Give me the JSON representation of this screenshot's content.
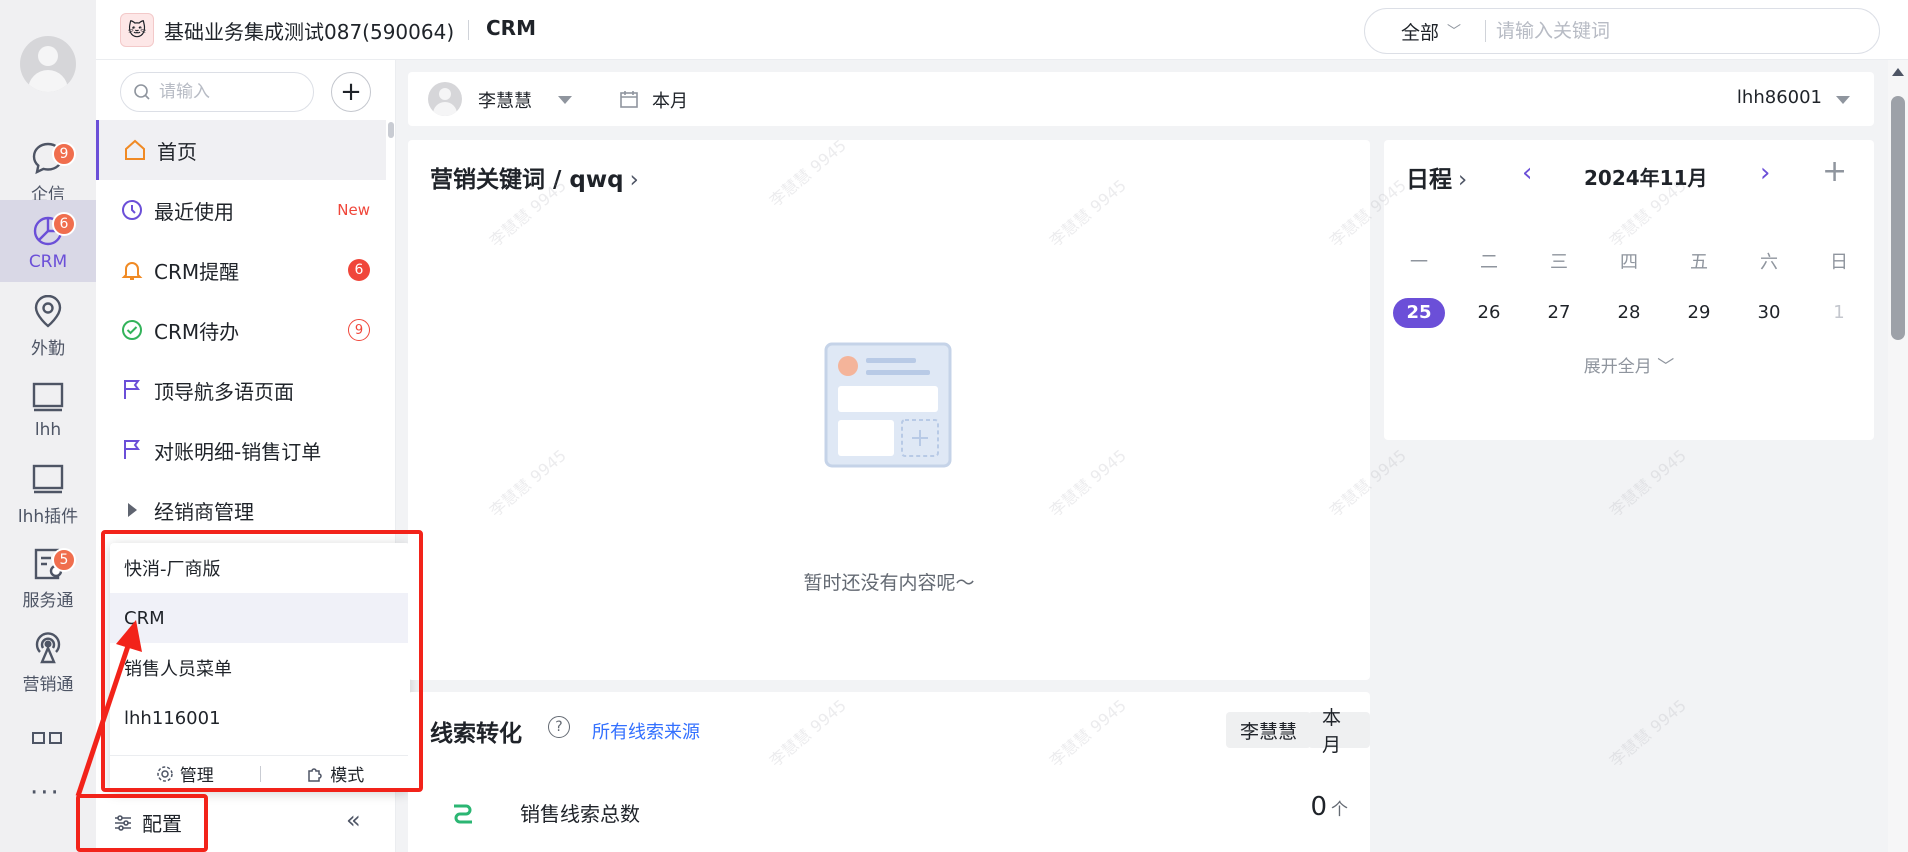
{
  "rail": {
    "items": [
      {
        "label": "企信",
        "badge": "9",
        "icon": "chat-bubble-icon"
      },
      {
        "label": "CRM",
        "badge": "6",
        "icon": "pie-chart-icon"
      },
      {
        "label": "外勤",
        "badge": "",
        "icon": "location-pin-icon"
      },
      {
        "label": "lhh",
        "badge": "",
        "icon": "monitor-icon"
      },
      {
        "label": "lhh插件",
        "badge": "",
        "icon": "monitor-icon"
      },
      {
        "label": "服务通",
        "badge": "5",
        "icon": "service-tool-icon"
      },
      {
        "label": "营销通",
        "badge": "",
        "icon": "broadcast-icon"
      }
    ],
    "more": "···"
  },
  "header": {
    "company": "基础业务集成测试087(590064)",
    "module": "CRM",
    "search_scope": "全部",
    "search_placeholder": "请输入关键词"
  },
  "nav": {
    "search_placeholder": "请输入",
    "items": [
      {
        "label": "首页",
        "right": ""
      },
      {
        "label": "最近使用",
        "right": "New"
      },
      {
        "label": "CRM提醒",
        "right": "6"
      },
      {
        "label": "CRM待办",
        "right": "9"
      },
      {
        "label": "顶导航多语页面",
        "right": ""
      },
      {
        "label": "对账明细-销售订单",
        "right": ""
      },
      {
        "label": "经销商管理",
        "right": ""
      }
    ],
    "config_label": "配置",
    "collapse": "«"
  },
  "popover": {
    "items": [
      "快消-厂商版",
      "CRM",
      "销售人员菜单",
      "lhh116001"
    ],
    "selected": "CRM",
    "manage": "管理",
    "mode": "模式"
  },
  "filterbar": {
    "user": "李慧慧",
    "period": "本月",
    "account": "lhh86001"
  },
  "keyword_card": {
    "title": "营销关键词 / qwq",
    "empty_text": "暂时还没有内容呢～"
  },
  "calendar": {
    "title": "日程",
    "month": "2024年11月",
    "weekdays": [
      "一",
      "二",
      "三",
      "四",
      "五",
      "六",
      "日"
    ],
    "days": [
      "25",
      "26",
      "27",
      "28",
      "29",
      "30",
      "1"
    ],
    "today": "25",
    "expand": "展开全月"
  },
  "lead_card": {
    "title": "线索转化",
    "source_link": "所有线索来源",
    "chip_user": "李慧慧",
    "chip_period": "本月",
    "row_label": "销售线索总数",
    "row_value": "0",
    "row_unit": "个"
  },
  "watermark": "李慧慧 9945",
  "colors": {
    "accent": "#6b4fd8",
    "badge": "#f06e4e",
    "annotation": "#f2231a",
    "link": "#3370ff"
  }
}
